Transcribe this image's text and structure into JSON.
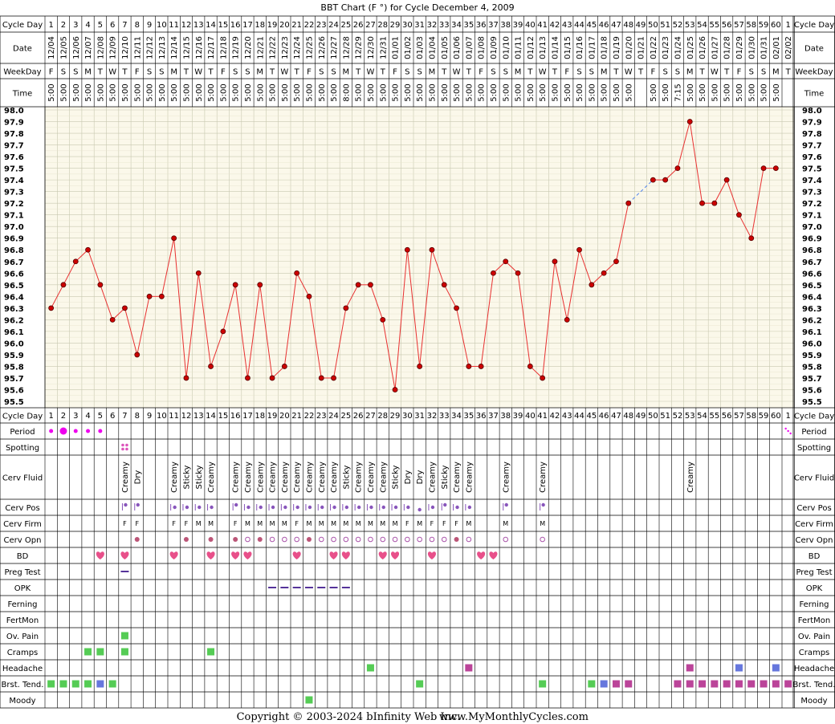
{
  "title": "BBT Chart (F °) for Cycle December 4, 2009",
  "copyright": "Copyright © 2003-2024 bInfinity Web Inc.",
  "website": "www.MyMonthlyCycles.com",
  "row_labels": {
    "cycle_day": "Cycle Day",
    "date": "Date",
    "weekday": "WeekDay",
    "time": "Time",
    "period": "Period",
    "spotting": "Spotting",
    "cerv_fluid": "Cerv Fluid",
    "cerv_pos": "Cerv Pos",
    "cerv_firm": "Cerv Firm",
    "cerv_opn": "Cerv Opn",
    "bd": "BD",
    "preg_test": "Preg Test",
    "opk": "OPK",
    "ferning": "Ferning",
    "fertmon": "FertMon",
    "ov_pain": "Ov. Pain",
    "cramps": "Cramps",
    "headache": "Headache",
    "brst_tend": "Brst. Tend.",
    "moody": "Moody"
  },
  "colors": {
    "temp_line": "#e83030",
    "temp_point": "#cc0000",
    "grid": "#c8c8b0",
    "chart_bg": "#fbf8ea",
    "period": "#ee00ee",
    "bd": "#e8508a",
    "green": "#55cc55",
    "blue": "#6677dd",
    "magenta": "#bb4499",
    "purple": "#8855bb",
    "firm": "#aa55aa"
  },
  "columns": {
    "cycle_days": [
      "1",
      "2",
      "3",
      "4",
      "5",
      "6",
      "7",
      "8",
      "9",
      "10",
      "11",
      "12",
      "13",
      "14",
      "15",
      "16",
      "17",
      "18",
      "19",
      "20",
      "21",
      "22",
      "23",
      "24",
      "25",
      "26",
      "27",
      "28",
      "29",
      "30",
      "31",
      "32",
      "33",
      "34",
      "35",
      "36",
      "37",
      "38",
      "39",
      "40",
      "41",
      "42",
      "43",
      "44",
      "45",
      "46",
      "47",
      "48",
      "49",
      "50",
      "51",
      "52",
      "53",
      "54",
      "55",
      "56",
      "57",
      "58",
      "59",
      "60",
      "1"
    ],
    "dates": [
      "12/04",
      "12/05",
      "12/06",
      "12/07",
      "12/08",
      "12/09",
      "12/10",
      "12/11",
      "12/12",
      "12/13",
      "12/14",
      "12/15",
      "12/16",
      "12/17",
      "12/18",
      "12/19",
      "12/20",
      "12/21",
      "12/22",
      "12/23",
      "12/24",
      "12/25",
      "12/26",
      "12/27",
      "12/28",
      "12/29",
      "12/30",
      "12/31",
      "01/01",
      "01/02",
      "01/03",
      "01/04",
      "01/05",
      "01/06",
      "01/07",
      "01/08",
      "01/09",
      "01/10",
      "01/11",
      "01/12",
      "01/13",
      "01/14",
      "01/15",
      "01/16",
      "01/17",
      "01/18",
      "01/19",
      "01/20",
      "01/21",
      "01/22",
      "01/23",
      "01/24",
      "01/25",
      "01/26",
      "01/27",
      "01/28",
      "01/29",
      "01/30",
      "01/31",
      "02/01",
      "02/02"
    ],
    "weekdays": [
      "F",
      "S",
      "S",
      "M",
      "T",
      "W",
      "T",
      "F",
      "S",
      "S",
      "M",
      "T",
      "W",
      "T",
      "F",
      "S",
      "S",
      "M",
      "T",
      "W",
      "T",
      "F",
      "S",
      "S",
      "M",
      "T",
      "W",
      "T",
      "F",
      "S",
      "S",
      "M",
      "T",
      "W",
      "T",
      "F",
      "S",
      "S",
      "M",
      "T",
      "W",
      "T",
      "F",
      "S",
      "S",
      "M",
      "T",
      "W",
      "T",
      "F",
      "S",
      "S",
      "M",
      "T",
      "W",
      "T",
      "F",
      "S",
      "S",
      "M",
      "T"
    ],
    "times": [
      "5:00",
      "5:00",
      "5:00",
      "5:00",
      "5:00",
      "5:00",
      "5:00",
      "5:00",
      "5:00",
      "5:00",
      "5:00",
      "5:00",
      "5:00",
      "5:00",
      "5:00",
      "5:00",
      "5:00",
      "5:00",
      "5:00",
      "5:00",
      "5:00",
      "5:00",
      "5:00",
      "5:00",
      "8:00",
      "5:00",
      "5:00",
      "5:00",
      "5:00",
      "5:00",
      "5:00",
      "5:00",
      "5:00",
      "5:00",
      "5:00",
      "5:00",
      "5:00",
      "5:00",
      "5:00",
      "5:00",
      "5:00",
      "5:00",
      "5:00",
      "5:00",
      "5:00",
      "5:00",
      "5:00",
      "5:00",
      "",
      "5:00",
      "5:00",
      "7:15",
      "5:00",
      "5:00",
      "5:00",
      "5:00",
      "5:00",
      "5:00",
      "5:00",
      "5:00",
      ""
    ]
  },
  "chart_data": {
    "type": "line",
    "title": "BBT Chart (F °) for Cycle December 4, 2009",
    "x": [
      "1",
      "2",
      "3",
      "4",
      "5",
      "6",
      "7",
      "8",
      "9",
      "10",
      "11",
      "12",
      "13",
      "14",
      "15",
      "16",
      "17",
      "18",
      "19",
      "20",
      "21",
      "22",
      "23",
      "24",
      "25",
      "26",
      "27",
      "28",
      "29",
      "30",
      "31",
      "32",
      "33",
      "34",
      "35",
      "36",
      "37",
      "38",
      "39",
      "40",
      "41",
      "42",
      "43",
      "44",
      "45",
      "46",
      "47",
      "48",
      "49",
      "50",
      "51",
      "52",
      "53",
      "54",
      "55",
      "56",
      "57",
      "58",
      "59",
      "60",
      "1"
    ],
    "series": [
      {
        "values": [
          96.3,
          96.5,
          96.7,
          96.8,
          96.5,
          96.2,
          96.3,
          95.9,
          96.4,
          96.4,
          96.9,
          95.7,
          96.6,
          95.8,
          96.1,
          96.5,
          95.7,
          96.5,
          95.7,
          95.8,
          96.6,
          96.4,
          95.7,
          95.7,
          96.3,
          96.5,
          96.5,
          96.2,
          95.6,
          96.8,
          95.8,
          96.8,
          96.5,
          96.3,
          95.8,
          95.8,
          96.6,
          96.7,
          96.6,
          95.8,
          95.7,
          96.7,
          96.2,
          96.8,
          96.5,
          96.6,
          96.7,
          97.2,
          null,
          97.4,
          97.4,
          97.5,
          97.9,
          97.2,
          97.2,
          97.4,
          97.1,
          96.9,
          97.5,
          97.5,
          null
        ]
      }
    ],
    "ylim": [
      95.5,
      98.0
    ],
    "yticks": [
      "98.0",
      "97.9",
      "97.8",
      "97.7",
      "97.6",
      "97.5",
      "97.4",
      "97.3",
      "97.2",
      "97.1",
      "97.0",
      "96.9",
      "96.8",
      "96.7",
      "96.6",
      "96.5",
      "96.4",
      "96.3",
      "96.2",
      "96.1",
      "96.0",
      "95.9",
      "95.8",
      "95.7",
      "95.6",
      "95.5"
    ],
    "grid": true
  },
  "observations": {
    "period": [
      {
        "day": 1,
        "kind": "small"
      },
      {
        "day": 2,
        "kind": "large"
      },
      {
        "day": 3,
        "kind": "small"
      },
      {
        "day": 4,
        "kind": "small"
      },
      {
        "day": 5,
        "kind": "small"
      },
      {
        "day": 61,
        "kind": "dots"
      }
    ],
    "spotting_days": [
      7
    ],
    "cerv_fluid": [
      {
        "day": 7,
        "text": "Creamy"
      },
      {
        "day": 8,
        "text": "Dry"
      },
      {
        "day": 11,
        "text": "Creamy"
      },
      {
        "day": 12,
        "text": "Sticky"
      },
      {
        "day": 13,
        "text": "Sticky"
      },
      {
        "day": 14,
        "text": "Creamy"
      },
      {
        "day": 16,
        "text": "Creamy"
      },
      {
        "day": 17,
        "text": "Creamy"
      },
      {
        "day": 18,
        "text": "Creamy"
      },
      {
        "day": 19,
        "text": "Creamy"
      },
      {
        "day": 20,
        "text": "Creamy"
      },
      {
        "day": 21,
        "text": "Creamy"
      },
      {
        "day": 22,
        "text": "Creamy"
      },
      {
        "day": 23,
        "text": "Creamy"
      },
      {
        "day": 24,
        "text": "Creamy"
      },
      {
        "day": 25,
        "text": "Sticky"
      },
      {
        "day": 26,
        "text": "Creamy"
      },
      {
        "day": 27,
        "text": "Creamy"
      },
      {
        "day": 28,
        "text": "Creamy"
      },
      {
        "day": 29,
        "text": "Sticky"
      },
      {
        "day": 30,
        "text": "Dry"
      },
      {
        "day": 31,
        "text": "Dry"
      },
      {
        "day": 32,
        "text": "Creamy"
      },
      {
        "day": 33,
        "text": "Sticky"
      },
      {
        "day": 34,
        "text": "Creamy"
      },
      {
        "day": 35,
        "text": "Creamy"
      },
      {
        "day": 38,
        "text": "Creamy"
      },
      {
        "day": 41,
        "text": "Creamy"
      },
      {
        "day": 53,
        "text": "Creamy"
      }
    ],
    "cerv_pos": [
      {
        "day": 7,
        "kind": "high"
      },
      {
        "day": 8,
        "kind": "high"
      },
      {
        "day": 11,
        "kind": "mid"
      },
      {
        "day": 12,
        "kind": "mid"
      },
      {
        "day": 13,
        "kind": "mid"
      },
      {
        "day": 14,
        "kind": "mid"
      },
      {
        "day": 16,
        "kind": "high"
      },
      {
        "day": 17,
        "kind": "mid"
      },
      {
        "day": 18,
        "kind": "mid"
      },
      {
        "day": 19,
        "kind": "mid"
      },
      {
        "day": 20,
        "kind": "mid"
      },
      {
        "day": 21,
        "kind": "mid"
      },
      {
        "day": 22,
        "kind": "mid"
      },
      {
        "day": 23,
        "kind": "mid"
      },
      {
        "day": 24,
        "kind": "mid"
      },
      {
        "day": 25,
        "kind": "mid"
      },
      {
        "day": 26,
        "kind": "mid"
      },
      {
        "day": 27,
        "kind": "mid"
      },
      {
        "day": 28,
        "kind": "mid"
      },
      {
        "day": 29,
        "kind": "mid"
      },
      {
        "day": 30,
        "kind": "mid"
      },
      {
        "day": 31,
        "kind": "low"
      },
      {
        "day": 32,
        "kind": "mid"
      },
      {
        "day": 33,
        "kind": "high"
      },
      {
        "day": 34,
        "kind": "mid"
      },
      {
        "day": 35,
        "kind": "mid"
      },
      {
        "day": 38,
        "kind": "high"
      },
      {
        "day": 41,
        "kind": "high"
      }
    ],
    "cerv_firm": [
      {
        "day": 7,
        "text": "F"
      },
      {
        "day": 8,
        "text": "F"
      },
      {
        "day": 11,
        "text": "F"
      },
      {
        "day": 12,
        "text": "F"
      },
      {
        "day": 13,
        "text": "M"
      },
      {
        "day": 14,
        "text": "M"
      },
      {
        "day": 16,
        "text": "F"
      },
      {
        "day": 17,
        "text": "M"
      },
      {
        "day": 18,
        "text": "M"
      },
      {
        "day": 19,
        "text": "M"
      },
      {
        "day": 20,
        "text": "M"
      },
      {
        "day": 21,
        "text": "F"
      },
      {
        "day": 22,
        "text": "M"
      },
      {
        "day": 23,
        "text": "M"
      },
      {
        "day": 24,
        "text": "M"
      },
      {
        "day": 25,
        "text": "M"
      },
      {
        "day": 26,
        "text": "M"
      },
      {
        "day": 27,
        "text": "M"
      },
      {
        "day": 28,
        "text": "M"
      },
      {
        "day": 29,
        "text": "M"
      },
      {
        "day": 30,
        "text": "F"
      },
      {
        "day": 31,
        "text": "M"
      },
      {
        "day": 32,
        "text": "F"
      },
      {
        "day": 33,
        "text": "F"
      },
      {
        "day": 34,
        "text": "F"
      },
      {
        "day": 35,
        "text": "M"
      },
      {
        "day": 38,
        "text": "M"
      },
      {
        "day": 41,
        "text": "M"
      }
    ],
    "cerv_opn": [
      {
        "day": 8,
        "kind": "filled"
      },
      {
        "day": 12,
        "kind": "filled"
      },
      {
        "day": 14,
        "kind": "filled"
      },
      {
        "day": 16,
        "kind": "filled"
      },
      {
        "day": 17,
        "kind": "open"
      },
      {
        "day": 18,
        "kind": "filled"
      },
      {
        "day": 19,
        "kind": "open"
      },
      {
        "day": 20,
        "kind": "open"
      },
      {
        "day": 21,
        "kind": "open"
      },
      {
        "day": 22,
        "kind": "filled"
      },
      {
        "day": 23,
        "kind": "open"
      },
      {
        "day": 24,
        "kind": "open"
      },
      {
        "day": 25,
        "kind": "open"
      },
      {
        "day": 26,
        "kind": "open"
      },
      {
        "day": 27,
        "kind": "open"
      },
      {
        "day": 28,
        "kind": "open"
      },
      {
        "day": 29,
        "kind": "open"
      },
      {
        "day": 30,
        "kind": "open"
      },
      {
        "day": 31,
        "kind": "open"
      },
      {
        "day": 32,
        "kind": "open"
      },
      {
        "day": 33,
        "kind": "open"
      },
      {
        "day": 34,
        "kind": "filled"
      },
      {
        "day": 35,
        "kind": "open"
      },
      {
        "day": 38,
        "kind": "open"
      },
      {
        "day": 41,
        "kind": "open"
      }
    ],
    "bd_days": [
      5,
      7,
      11,
      14,
      16,
      17,
      21,
      24,
      25,
      28,
      29,
      32,
      36,
      37
    ],
    "preg_test_days": [
      7
    ],
    "opk_days": [
      19,
      20,
      21,
      22,
      23,
      24,
      25
    ],
    "ov_pain": [
      {
        "day": 7,
        "color": "green"
      }
    ],
    "cramps": [
      {
        "day": 4,
        "color": "green"
      },
      {
        "day": 5,
        "color": "green"
      },
      {
        "day": 7,
        "color": "green"
      },
      {
        "day": 14,
        "color": "green"
      }
    ],
    "headache": [
      {
        "day": 27,
        "color": "green"
      },
      {
        "day": 35,
        "color": "magenta"
      },
      {
        "day": 53,
        "color": "magenta"
      },
      {
        "day": 57,
        "color": "blue"
      },
      {
        "day": 60,
        "color": "blue"
      }
    ],
    "brst_tend": [
      {
        "day": 1,
        "color": "green"
      },
      {
        "day": 2,
        "color": "green"
      },
      {
        "day": 3,
        "color": "green"
      },
      {
        "day": 4,
        "color": "green"
      },
      {
        "day": 5,
        "color": "blue"
      },
      {
        "day": 6,
        "color": "green"
      },
      {
        "day": 31,
        "color": "green"
      },
      {
        "day": 41,
        "color": "green"
      },
      {
        "day": 45,
        "color": "green"
      },
      {
        "day": 46,
        "color": "blue"
      },
      {
        "day": 47,
        "color": "magenta"
      },
      {
        "day": 48,
        "color": "magenta"
      },
      {
        "day": 52,
        "color": "magenta"
      },
      {
        "day": 53,
        "color": "magenta"
      },
      {
        "day": 54,
        "color": "magenta"
      },
      {
        "day": 55,
        "color": "magenta"
      },
      {
        "day": 56,
        "color": "magenta"
      },
      {
        "day": 57,
        "color": "magenta"
      },
      {
        "day": 58,
        "color": "magenta"
      },
      {
        "day": 59,
        "color": "magenta"
      },
      {
        "day": 60,
        "color": "magenta"
      },
      {
        "day": 61,
        "color": "magenta"
      }
    ],
    "moody": [
      {
        "day": 22,
        "color": "green"
      }
    ]
  }
}
